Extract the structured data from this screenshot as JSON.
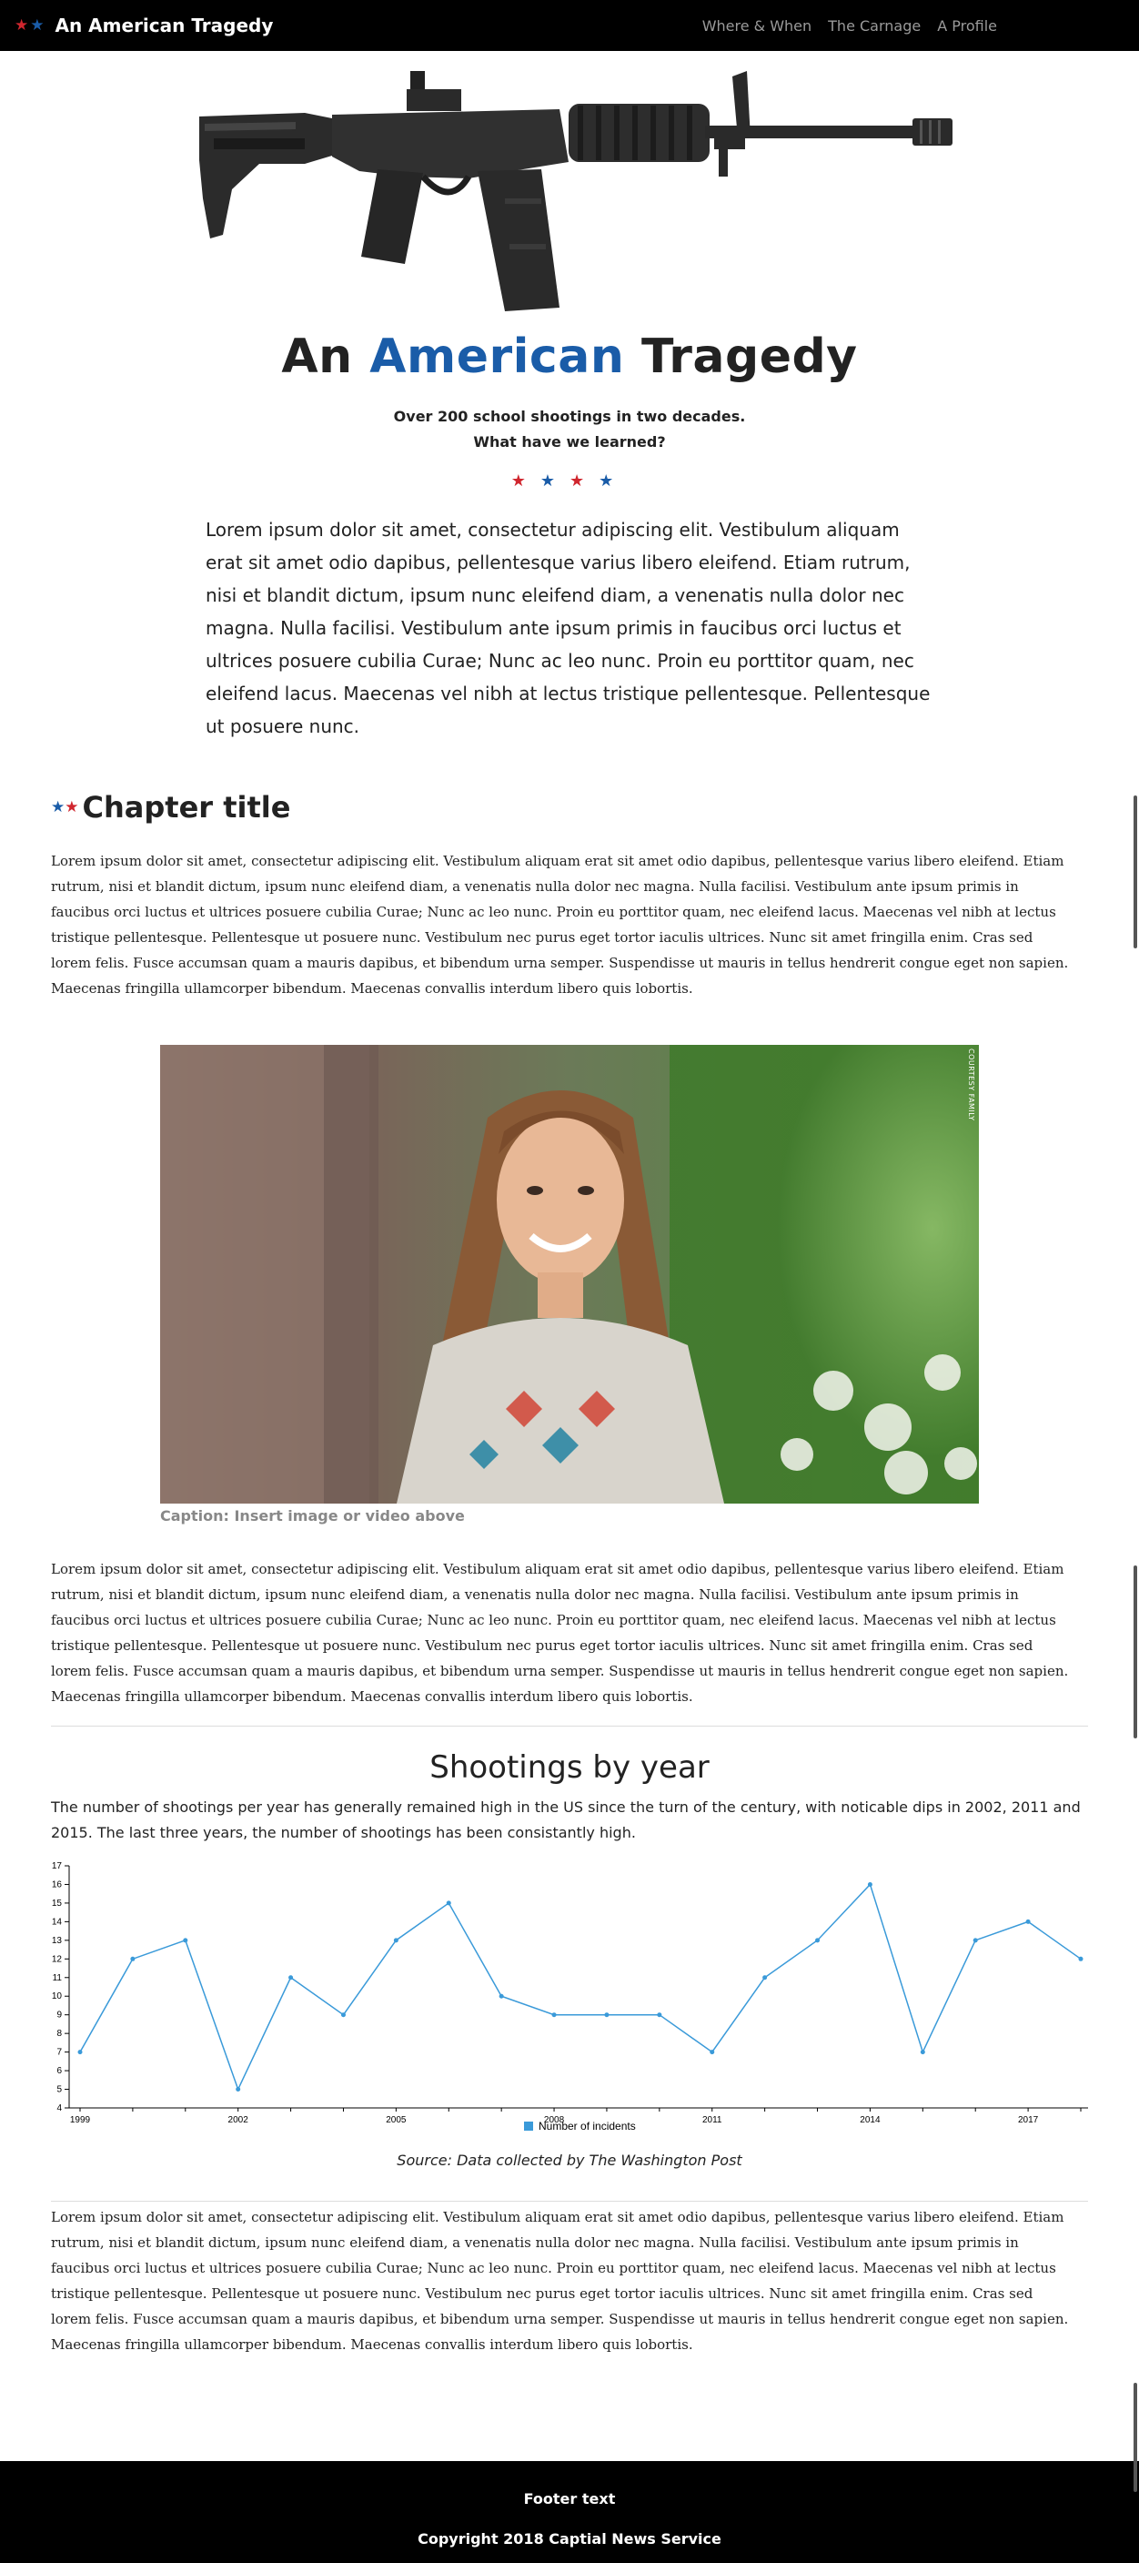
{
  "nav": {
    "brand_stars": [
      "★",
      "★"
    ],
    "brand_title": "An American Tragedy",
    "links": [
      "Where & When",
      "The Carnage",
      "A Profile"
    ]
  },
  "hero": {
    "title_part1": "An ",
    "title_accent": "American",
    "title_part2": " Tragedy",
    "subtitle_line1": "Over 200 school shootings in two decades.",
    "subtitle_line2": "What have we learned?",
    "stars": "★★★★",
    "intro": "Lorem ipsum dolor sit amet, consectetur adipiscing elit. Vestibulum aliquam erat sit amet odio dapibus, pellentesque varius libero eleifend. Etiam rutrum, nisi et blandit dictum, ipsum nunc eleifend diam, a venenatis nulla dolor nec magna. Nulla facilisi. Vestibulum ante ipsum primis in faucibus orci luctus et ultrices posuere cubilia Curae; Nunc ac leo nunc. Proin eu porttitor quam, nec eleifend lacus. Maecenas vel nibh at lectus tristique pellentesque. Pellentesque ut posuere nunc."
  },
  "chapter": {
    "stars": "★★",
    "title": "Chapter title",
    "paragraph1": "Lorem ipsum dolor sit amet, consectetur adipiscing elit. Vestibulum aliquam erat sit amet odio dapibus, pellentesque varius libero eleifend. Etiam rutrum, nisi et blandit dictum, ipsum nunc eleifend diam, a venenatis nulla dolor nec magna. Nulla facilisi. Vestibulum ante ipsum primis in faucibus orci luctus et ultrices posuere cubilia Curae; Nunc ac leo nunc. Proin eu porttitor quam, nec eleifend lacus. Maecenas vel nibh at lectus tristique pellentesque. Pellentesque ut posuere nunc. Vestibulum nec purus eget tortor iaculis ultrices. Nunc sit amet fringilla enim. Cras sed lorem felis. Fusce accumsan quam a mauris dapibus, et bibendum urna semper. Suspendisse ut mauris in tellus hendrerit congue eget non sapien. Maecenas fringilla ullamcorper bibendum. Maecenas convallis interdum libero quis lobortis.",
    "photo_credit": "COURTESY FAMILY",
    "caption": "Caption: Insert image or video above",
    "paragraph2": "Lorem ipsum dolor sit amet, consectetur adipiscing elit. Vestibulum aliquam erat sit amet odio dapibus, pellentesque varius libero eleifend. Etiam rutrum, nisi et blandit dictum, ipsum nunc eleifend diam, a venenatis nulla dolor nec magna. Nulla facilisi. Vestibulum ante ipsum primis in faucibus orci luctus et ultrices posuere cubilia Curae; Nunc ac leo nunc. Proin eu porttitor quam, nec eleifend lacus. Maecenas vel nibh at lectus tristique pellentesque. Pellentesque ut posuere nunc. Vestibulum nec purus eget tortor iaculis ultrices. Nunc sit amet fringilla enim. Cras sed lorem felis. Fusce accumsan quam a mauris dapibus, et bibendum urna semper. Suspendisse ut mauris in tellus hendrerit congue eget non sapien. Maecenas fringilla ullamcorper bibendum. Maecenas convallis interdum libero quis lobortis.",
    "paragraph3": "Lorem ipsum dolor sit amet, consectetur adipiscing elit. Vestibulum aliquam erat sit amet odio dapibus, pellentesque varius libero eleifend. Etiam rutrum, nisi et blandit dictum, ipsum nunc eleifend diam, a venenatis nulla dolor nec magna. Nulla facilisi. Vestibulum ante ipsum primis in faucibus orci luctus et ultrices posuere cubilia Curae; Nunc ac leo nunc. Proin eu porttitor quam, nec eleifend lacus. Maecenas vel nibh at lectus tristique pellentesque. Pellentesque ut posuere nunc. Vestibulum nec purus eget tortor iaculis ultrices. Nunc sit amet fringilla enim. Cras sed lorem felis. Fusce accumsan quam a mauris dapibus, et bibendum urna semper. Suspendisse ut mauris in tellus hendrerit congue eget non sapien. Maecenas fringilla ullamcorper bibendum. Maecenas convallis interdum libero quis lobortis."
  },
  "chart_section": {
    "title": "Shootings by year",
    "description": "The number of shootings per year has generally remained high in the US since the turn of the century, with noticable dips in 2002, 2011 and 2015. The last three years, the number of shootings has been consistantly high.",
    "source": "Source: Data collected by The Washington Post"
  },
  "chart_data": {
    "type": "line",
    "title": "Shootings by year",
    "xlabel": "",
    "ylabel": "",
    "x": [
      1999,
      2000,
      2001,
      2002,
      2003,
      2004,
      2005,
      2006,
      2007,
      2008,
      2009,
      2010,
      2011,
      2012,
      2013,
      2014,
      2015,
      2016,
      2017,
      2018
    ],
    "series": [
      {
        "name": "Number of incidents",
        "values": [
          7,
          12,
          13,
          5,
          11,
          9,
          13,
          15,
          10,
          9,
          9,
          9,
          7,
          11,
          13,
          16,
          7,
          13,
          14,
          12
        ]
      }
    ],
    "ylim": [
      4,
      17
    ],
    "y_ticks": [
      4,
      5,
      6,
      7,
      8,
      9,
      10,
      11,
      12,
      13,
      14,
      15,
      16,
      17
    ],
    "x_tick_labels": [
      "1999",
      "2002",
      "2005",
      "2008",
      "2011",
      "2014",
      "2017"
    ],
    "legend": "bottom-center",
    "line_color": "#3a9ad9"
  },
  "footer": {
    "text": "Footer text",
    "copyright": "Copyright 2018 Captial News Service"
  },
  "colors": {
    "red_star": "#d0262e",
    "blue_star": "#1a5ca8",
    "accent": "#1a5ca8"
  }
}
